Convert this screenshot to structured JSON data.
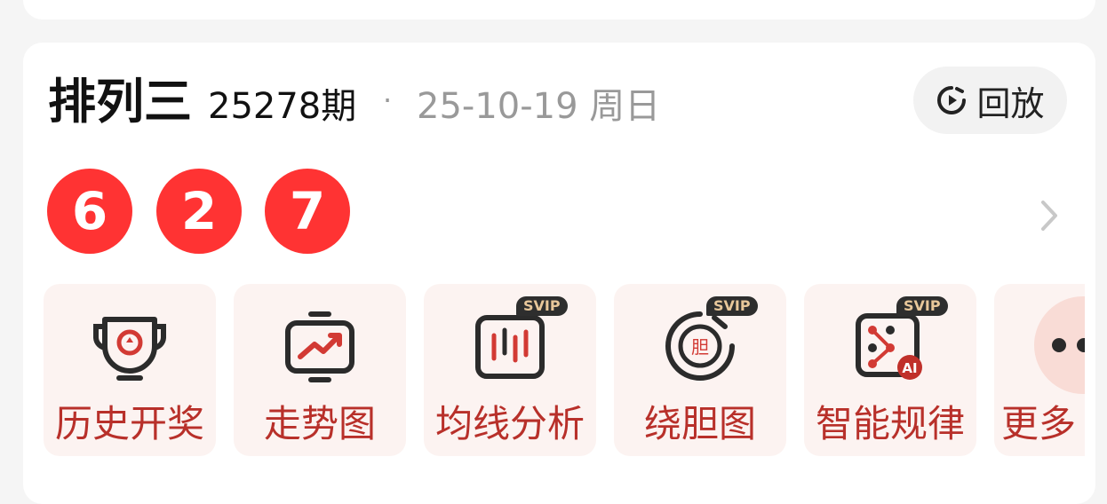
{
  "lottery": {
    "name": "排列三",
    "issue": "25278期",
    "separator": "·",
    "date": "25-10-19 周日"
  },
  "replay": {
    "label": "回放",
    "icon": "replay-clock-icon"
  },
  "numbers": [
    "6",
    "2",
    "7"
  ],
  "colors": {
    "ball": "#ff3333",
    "tile_bg": "#fcf3f1",
    "tile_text": "#b8302a",
    "svip_bg": "#2e2e2e",
    "svip_text": "#e8c79a"
  },
  "tools": [
    {
      "label": "历史开奖",
      "icon": "trophy-icon",
      "badge": ""
    },
    {
      "label": "走势图",
      "icon": "trend-chart-icon",
      "badge": ""
    },
    {
      "label": "均线分析",
      "icon": "candlestick-icon",
      "badge": "SVIP"
    },
    {
      "label": "绕胆图",
      "icon": "cycle-dan-icon",
      "badge": "SVIP",
      "icon_text": "胆"
    },
    {
      "label": "智能规律",
      "icon": "ai-pattern-icon",
      "badge": "SVIP",
      "icon_text": "AI"
    },
    {
      "label": "更多",
      "icon": "more-dots-icon",
      "badge": ""
    }
  ]
}
